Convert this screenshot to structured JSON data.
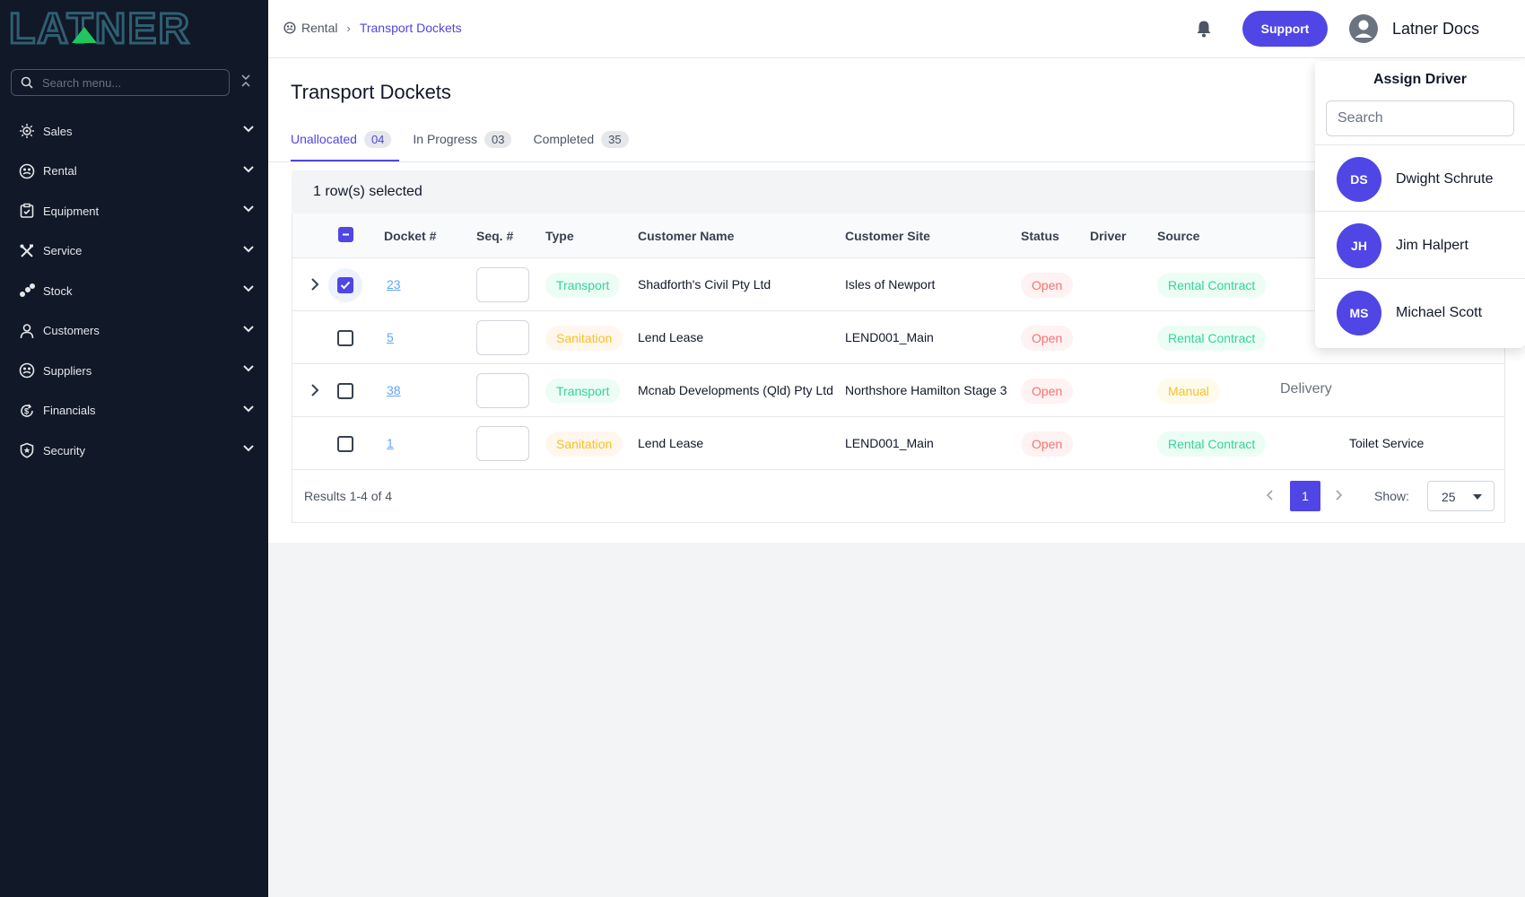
{
  "brand": {
    "name": "LATNER",
    "accent": "#4f46e5",
    "sidebar_bg": "#111827"
  },
  "sidebar": {
    "search_placeholder": "Search menu...",
    "items": [
      {
        "label": "Sales",
        "icon": "sales-icon"
      },
      {
        "label": "Rental",
        "icon": "rental-icon"
      },
      {
        "label": "Equipment",
        "icon": "equipment-icon"
      },
      {
        "label": "Service",
        "icon": "service-icon"
      },
      {
        "label": "Stock",
        "icon": "stock-icon"
      },
      {
        "label": "Customers",
        "icon": "customers-icon"
      },
      {
        "label": "Suppliers",
        "icon": "suppliers-icon"
      },
      {
        "label": "Financials",
        "icon": "financials-icon"
      },
      {
        "label": "Security",
        "icon": "security-icon"
      }
    ]
  },
  "header": {
    "breadcrumb": [
      "Rental",
      "Transport Dockets"
    ],
    "support_label": "Support",
    "user_name": "Latner Docs"
  },
  "page": {
    "title": "Transport Dockets",
    "tabs": [
      {
        "label": "Unallocated",
        "count": "04",
        "active": true
      },
      {
        "label": "In Progress",
        "count": "03",
        "active": false
      },
      {
        "label": "Completed",
        "count": "35",
        "active": false
      }
    ],
    "selection_text": "1 row(s) selected"
  },
  "table": {
    "columns": [
      "Docket #",
      "Seq. #",
      "Type",
      "Customer Name",
      "Customer Site",
      "Status",
      "Driver",
      "Source"
    ],
    "rows": [
      {
        "docket": "23",
        "type": "Transport",
        "customer": "Shadforth's Civil Pty Ltd",
        "site": "Isles of Newport",
        "status": "Open",
        "source": "Rental Contract",
        "extra": "",
        "checked": true,
        "expandable": true
      },
      {
        "docket": "5",
        "type": "Sanitation",
        "customer": "Lend Lease",
        "site": "LEND001_Main",
        "status": "Open",
        "source": "Rental Contract",
        "extra": "",
        "checked": false,
        "expandable": false
      },
      {
        "docket": "38",
        "type": "Transport",
        "customer": "Mcnab Developments (Qld) Pty Ltd",
        "site": "Northshore Hamilton Stage 3",
        "status": "Open",
        "source": "Manual",
        "extra": "Delivery",
        "checked": false,
        "expandable": true
      },
      {
        "docket": "1",
        "type": "Sanitation",
        "customer": "Lend Lease",
        "site": "LEND001_Main",
        "status": "Open",
        "source": "Rental Contract",
        "extra": "Toilet Service",
        "checked": false,
        "expandable": false
      }
    ],
    "results_text": "Results 1-4 of 4",
    "current_page": "1",
    "show_label": "Show:",
    "page_size": "25"
  },
  "assign_driver": {
    "title": "Assign Driver",
    "search_placeholder": "Search",
    "drivers": [
      {
        "initials": "DS",
        "name": "Dwight Schrute"
      },
      {
        "initials": "JH",
        "name": "Jim Halpert"
      },
      {
        "initials": "MS",
        "name": "Michael Scott"
      }
    ]
  }
}
